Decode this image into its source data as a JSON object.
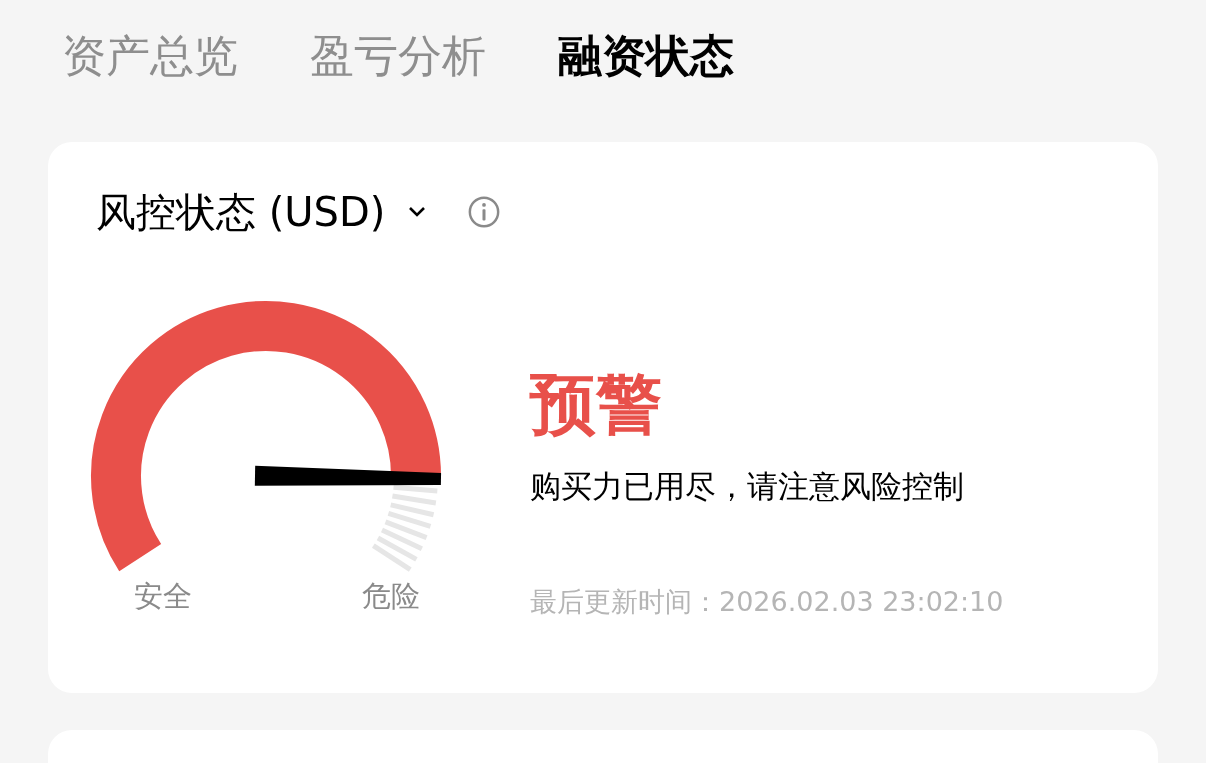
{
  "tabs": [
    {
      "label": "资产总览",
      "selected": false
    },
    {
      "label": "盈亏分析",
      "selected": false
    },
    {
      "label": "融资状态",
      "selected": true
    }
  ],
  "risk_card": {
    "title": "风控状态 (USD)",
    "gauge": {
      "low_label": "安全",
      "high_label": "危险"
    },
    "status": {
      "kind": "warning",
      "label": "预警",
      "message": "购买力已用尽，请注意风险控制"
    },
    "updated": "最后更新时间：2026.02.03 23:02:10"
  }
}
